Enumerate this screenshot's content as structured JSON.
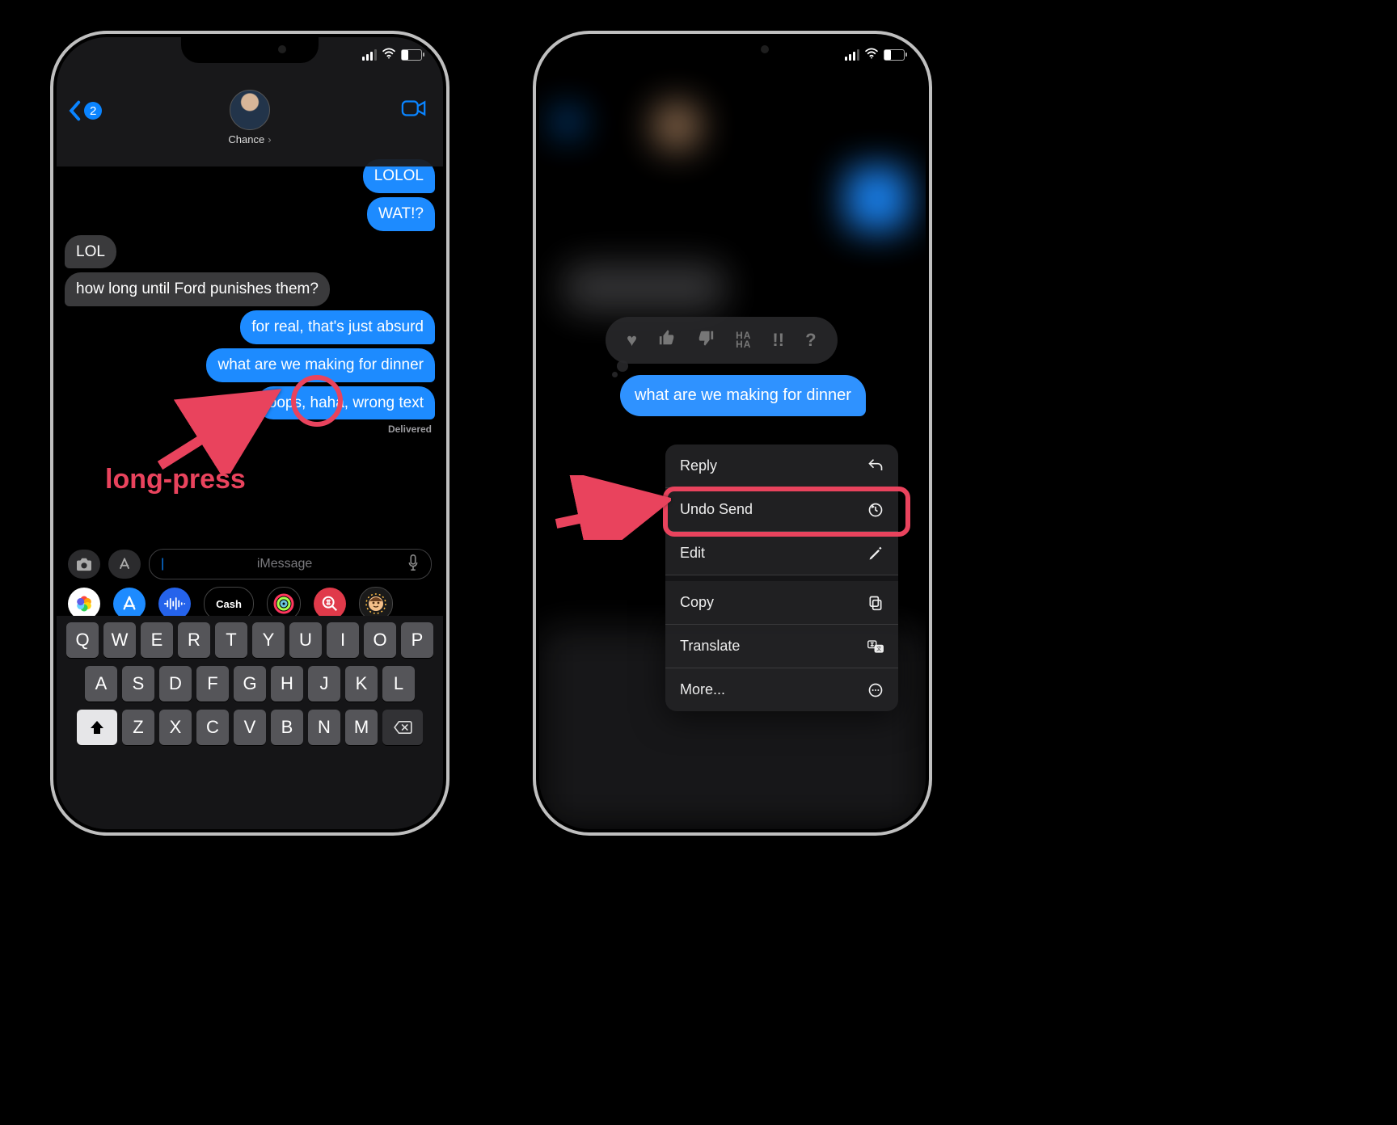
{
  "status": {
    "signal": 3,
    "wifi_icon": "wifi-icon",
    "battery_pct": 35
  },
  "header": {
    "back_count": "2",
    "contact_name": "Chance",
    "video_icon": "facetime-icon"
  },
  "messages": [
    {
      "dir": "out",
      "text": "LOLOL"
    },
    {
      "dir": "out",
      "text": "WAT!?"
    },
    {
      "dir": "in",
      "text": "LOL"
    },
    {
      "dir": "in",
      "text": "how long until Ford punishes them?"
    },
    {
      "dir": "out",
      "text": "for real, that's just absurd"
    },
    {
      "dir": "out",
      "text": "what are we making for dinner"
    },
    {
      "dir": "out",
      "text": "oops, haha, wrong text"
    }
  ],
  "delivered_label": "Delivered",
  "compose": {
    "placeholder": "iMessage",
    "camera_icon": "camera-icon",
    "apps_icon": "appstore-icon",
    "mic_icon": "mic-icon"
  },
  "app_strip": {
    "photos": "photos-app",
    "store": "appstore-app",
    "audio": "audio-messages-app",
    "cash_label": "Cash",
    "fitness": "fitness-app",
    "search": "hashtag-images-app",
    "memoji": "memoji-app"
  },
  "keyboard": {
    "row1": [
      "Q",
      "W",
      "E",
      "R",
      "T",
      "Y",
      "U",
      "I",
      "O",
      "P"
    ],
    "row2": [
      "A",
      "S",
      "D",
      "F",
      "G",
      "H",
      "J",
      "K",
      "L"
    ],
    "row3": [
      "Z",
      "X",
      "C",
      "V",
      "B",
      "N",
      "M"
    ],
    "shift_icon": "shift-key",
    "delete_icon": "delete-key"
  },
  "annotation": {
    "label": "long-press",
    "circle_target_index": 5
  },
  "phone2": {
    "tapback_icons": [
      "heart",
      "thumbs-up",
      "thumbs-down",
      "haha",
      "exclaim",
      "question"
    ],
    "selected_message": "what are we making for dinner",
    "menu": [
      {
        "label": "Reply",
        "icon": "reply-icon"
      },
      {
        "label": "Undo Send",
        "icon": "undo-icon"
      },
      {
        "label": "Edit",
        "icon": "pencil-icon"
      },
      {
        "label": "Copy",
        "icon": "copy-icon"
      },
      {
        "label": "Translate",
        "icon": "translate-icon"
      },
      {
        "label": "More...",
        "icon": "more-icon"
      }
    ],
    "highlight_index": 1
  }
}
